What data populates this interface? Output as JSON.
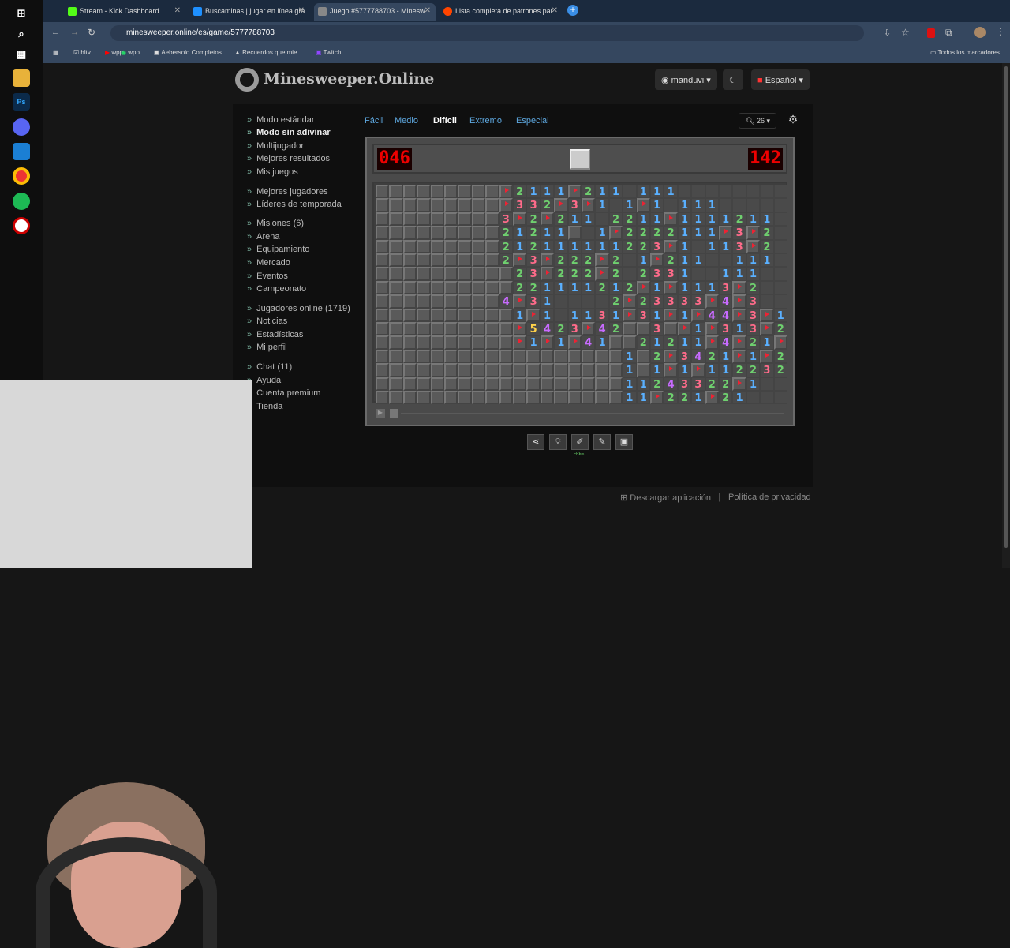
{
  "browser": {
    "tabs": [
      {
        "label": "Stream - Kick Dashboard",
        "color": "#53fc18"
      },
      {
        "label": "Buscaminas | jugar en línea gra",
        "color": "#1e90ff"
      },
      {
        "label": "Juego #5777788703 - Minesw",
        "color": "#888888"
      },
      {
        "label": "Lista completa de patrones par",
        "color": "#ff4500"
      }
    ],
    "url": "minesweeper.online/es/game/5777788703",
    "bookmarks": [
      "hltv",
      "wpp",
      "Aebersold Completos",
      "Recuerdos que mie...",
      "Twitch"
    ],
    "all_bookmarks": "Todos los marcadores"
  },
  "site": {
    "logo": "Minesweeper.Online",
    "user": "manduvi",
    "language": "Español",
    "theme_icon": "moon-icon"
  },
  "nav": {
    "group1": [
      "Modo estándar",
      "Modo sin adivinar",
      "Multijugador",
      "Mejores resultados",
      "Mis juegos"
    ],
    "group2": [
      "Mejores jugadores",
      "Líderes de temporada"
    ],
    "group3": [
      "Misiones (6)",
      "Arena",
      "Equipamiento",
      "Mercado",
      "Eventos",
      "Campeonato"
    ],
    "group4": [
      "Jugadores online (1719)",
      "Noticias",
      "Estadísticas",
      "Mi perfil"
    ],
    "group5": [
      "Chat (11)",
      "Ayuda",
      "Cuenta premium",
      "Tienda"
    ]
  },
  "modes": [
    "Fácil",
    "Medio",
    "Difícil",
    "Extremo",
    "Especial"
  ],
  "active_mode": "Difícil",
  "zoom": "26",
  "game": {
    "mines_left": "046",
    "timer": "142",
    "face": "smile"
  },
  "board_rows": [
    "HHHHHHHHHF2111F211O111OOOOOOOOO",
    "HHHHHHHHHF332F3F1O1F1O111OOOOO",
    "HHHHHHHHH3F2F211O2211F1111211",
    "HHHHHHHHH21211HO1F2222111F3F2",
    "HHHHHHHHH212111111223F1O113F2",
    "HHHHHHHHH2F3F222F2O1F211OO111",
    "HHHHHHHHHH23F222F2O2331OO111O",
    "HHHHHHHHHH221111212F1F1113F2O",
    "HHHHHHHHH4F31OOOO2F23333F4F3O",
    "HHHHHHHHHH1F1O1131F31F1F44F3F11",
    "HHHHHHHHHHF5423F42HH3HF1F313F2",
    "HHHHHHHHHHF1F1F41HH21211F4F21F3",
    "HHHHHHHHHHHHHHHHHH1H2F3421F1F2",
    "HHHHHHHHHHHHHHHHHH1H1F1F1122321",
    "HHHHHHHHHHHHHHHHHH11243322F1OO",
    "HHHHHHHHHHHHHHHHHH11F221F21OOO"
  ],
  "colors": {
    "1": "#5ab0ff",
    "2": "#6fd06f",
    "3": "#ff6b8a",
    "4": "#c86bff",
    "5": "#ffd24a"
  },
  "tools": [
    "share-icon",
    "hint-icon",
    "magic-icon",
    "edit-icon",
    "image-icon"
  ],
  "tool_badge": "FREE",
  "footer": {
    "app": "Descargar aplicación",
    "privacy": "Política de privacidad"
  }
}
